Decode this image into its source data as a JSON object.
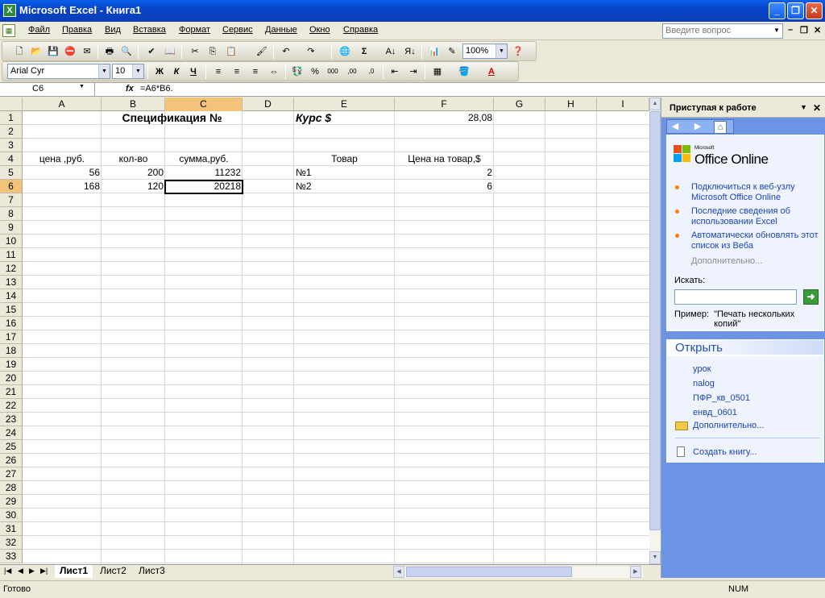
{
  "window": {
    "title": "Microsoft Excel - Книга1"
  },
  "menu": {
    "items": [
      "Файл",
      "Правка",
      "Вид",
      "Вставка",
      "Формат",
      "Сервис",
      "Данные",
      "Окно",
      "Справка"
    ],
    "ask_placeholder": "Введите вопрос"
  },
  "toolbar_standard": {
    "zoom": "100%"
  },
  "toolbar_format": {
    "font": "Arial Cyr",
    "size": "10"
  },
  "formula_bar": {
    "namebox": "C6",
    "fx": "fx",
    "formula": "=A6*B6."
  },
  "grid": {
    "columns": [
      "A",
      "B",
      "C",
      "D",
      "E",
      "F",
      "G",
      "H",
      "I"
    ],
    "rows": [
      "1",
      "2",
      "3",
      "4",
      "5",
      "6",
      "7",
      "8",
      "9",
      "10",
      "11",
      "12",
      "13",
      "14",
      "15",
      "16",
      "17",
      "18",
      "19",
      "20",
      "21",
      "22",
      "23",
      "24",
      "25",
      "26",
      "27",
      "28",
      "29",
      "30",
      "31",
      "32",
      "33"
    ],
    "cells": {
      "title": "Спецификация №",
      "rate_label": "Курс $",
      "rate_value": "28,08",
      "A4": "цена ,руб.",
      "B4": "кол-во",
      "C4": "сумма,руб.",
      "E4": "Товар",
      "F4": "Цена на товар,$",
      "A5": "56",
      "B5": "200",
      "C5": "11232",
      "E5": "№1",
      "F5": "2",
      "A6": "168",
      "B6": "120",
      "C6": "20218",
      "E6": "№2",
      "F6": "6"
    }
  },
  "sheet_tabs": [
    "Лист1",
    "Лист2",
    "Лист3"
  ],
  "status": {
    "left": "Готово",
    "num": "NUM"
  },
  "task_pane": {
    "title": "Приступая к работе",
    "logo_small": "Microsoft",
    "logo_big": "Office Online",
    "links": [
      "Подключиться к веб-узлу Microsoft Office Online",
      "Последние сведения об использовании Excel",
      "Автоматически обновлять этот список из Веба"
    ],
    "more": "Дополнительно...",
    "search_label": "Искать:",
    "example_label": "Пример:",
    "example_text": "\"Печать нескольких копий\"",
    "open_header": "Открыть",
    "files": [
      "урок",
      "nalog",
      "ПФР_кв_0501",
      "енвд_0601"
    ],
    "open_more": "Дополнительно...",
    "new_book": "Создать книгу..."
  }
}
